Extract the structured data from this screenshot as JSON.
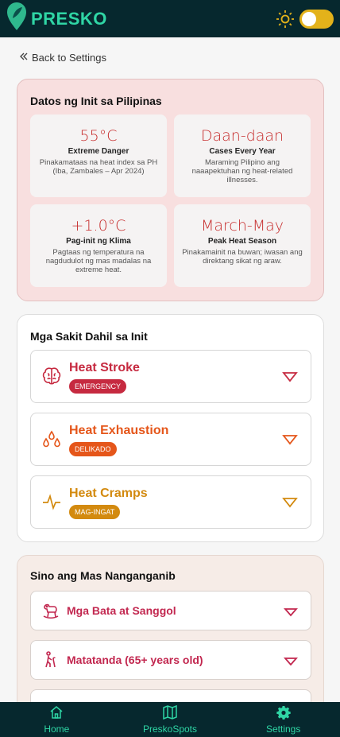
{
  "header": {
    "brand": "PRESKO",
    "logo_icon": "leaf-pin-icon",
    "theme_icon": "sun-icon",
    "toggle_state": "off"
  },
  "back": {
    "label": "Back to Settings"
  },
  "heat_data": {
    "title": "Datos ng Init sa Pilipinas",
    "tiles": [
      {
        "value": "55°C",
        "label": "Extreme Danger",
        "desc": "Pinakamataas na heat index sa PH (Iba, Zambales – Apr 2024)"
      },
      {
        "value": "Daan-daan",
        "label": "Cases Every Year",
        "desc": "Maraming Pilipino ang naaapektuhan ng heat-related illnesses."
      },
      {
        "value": "+1.0°C",
        "label": "Pag-init ng Klima",
        "desc": "Pagtaas ng temperatura na nagdudulot ng mas madalas na extreme heat."
      },
      {
        "value": "March-May",
        "label": "Peak Heat Season",
        "desc": "Pinakamainit na buwan; iwasan ang direktang sikat ng araw."
      }
    ]
  },
  "illnesses": {
    "title": "Mga Sakit Dahil sa Init",
    "items": [
      {
        "name": "Heat Stroke",
        "badge": "EMERGENCY",
        "color": "#c62a40",
        "icon": "brain-icon"
      },
      {
        "name": "Heat Exhaustion",
        "badge": "DELIKADO",
        "color": "#e5561a",
        "icon": "droplets-icon"
      },
      {
        "name": "Heat Cramps",
        "badge": "MAG-INGAT",
        "color": "#d38a0f",
        "icon": "pulse-icon"
      }
    ]
  },
  "risk_groups": {
    "title": "Sino ang Mas Nanganganib",
    "items": [
      {
        "name": "Mga Bata at Sanggol",
        "icon": "rocking-horse-icon"
      },
      {
        "name": "Matatanda (65+ years old)",
        "icon": "elderly-person-icon"
      }
    ]
  },
  "nav": {
    "items": [
      {
        "label": "Home",
        "icon": "home-icon"
      },
      {
        "label": "PreskoSpots",
        "icon": "map-icon"
      },
      {
        "label": "Settings",
        "icon": "gear-icon"
      }
    ]
  }
}
